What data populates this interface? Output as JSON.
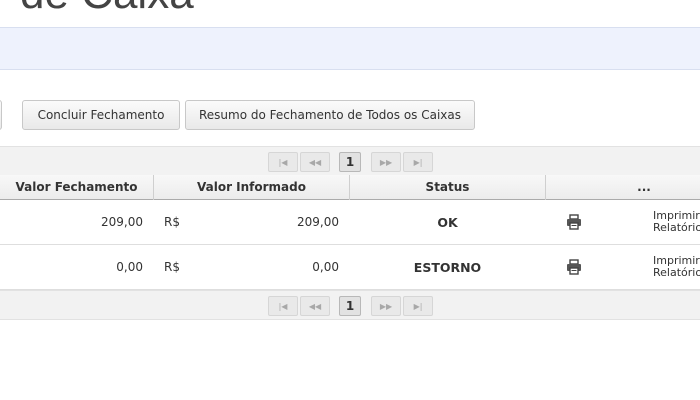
{
  "page": {
    "title": "de Caixa"
  },
  "toolbar": {
    "concluir_label": "Concluir Fechamento",
    "resumo_label": "Resumo do Fechamento de Todos os Caixas"
  },
  "pagination": {
    "current_page": "1"
  },
  "table": {
    "columns": [
      "Valor Fechamento",
      "Valor Informado",
      "Status",
      "..."
    ],
    "rows": [
      {
        "valor_fechamento": "209,00",
        "currency": "R$",
        "valor_informado": "209,00",
        "status": "OK",
        "action_line1": "Imprimir",
        "action_line2": "Relatório"
      },
      {
        "valor_fechamento": "0,00",
        "currency": "R$",
        "valor_informado": "0,00",
        "status": "ESTORNO",
        "action_line1": "Imprimir",
        "action_line2": "Relatório"
      }
    ]
  },
  "icons": {
    "print": "printer-icon",
    "first": "first-page-icon",
    "prev": "previous-page-icon",
    "next": "next-page-icon",
    "last": "last-page-icon"
  },
  "colors": {
    "info_bar": "#eef2fd",
    "header_border": "#aaaaaa"
  }
}
